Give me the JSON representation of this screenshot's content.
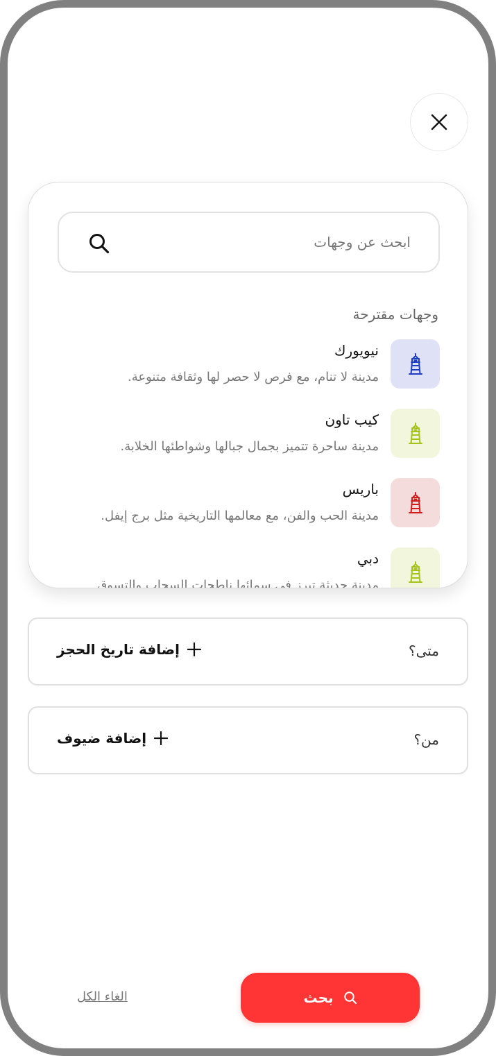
{
  "search": {
    "placeholder": "ابحث عن وجهات",
    "value": ""
  },
  "suggested": {
    "title": "وجهات مقترحة",
    "items": [
      {
        "name": "نيويورك",
        "description": "مدينة لا تنام، مع فرص لا حصر لها وثقافة متنوعة.",
        "thumb_bg": "#dfe1f7",
        "icon_color": "#1f3cc4",
        "icon": "lighthouse-icon"
      },
      {
        "name": "كيب تاون",
        "description": "مدينة ساحرة تتميز بجمال جبالها وشواطئها الخلابة.",
        "thumb_bg": "#f1f6dc",
        "icon_color": "#a6c21c",
        "icon": "lighthouse-icon"
      },
      {
        "name": "باريس",
        "description": "مدينة الحب والفن، مع معالمها التاريخية مثل برج إيفل.",
        "thumb_bg": "#f5dcdc",
        "icon_color": "#d31d1d",
        "icon": "lighthouse-icon"
      },
      {
        "name": "دبي",
        "description": "مدينة حديثة تبرز في سمائها ناطحات السحاب والتسوق",
        "thumb_bg": "#f1f6dc",
        "icon_color": "#a6c21c",
        "icon": "lighthouse-icon"
      }
    ]
  },
  "when": {
    "label": "متى؟",
    "action": "إضافة تاريخ الحجز"
  },
  "who": {
    "label": "من؟",
    "action": "إضافة ضيوف"
  },
  "footer": {
    "search_label": "بحث",
    "clear_label": "الغاء الكل"
  },
  "colors": {
    "accent": "#ff3535",
    "frame": "#808080"
  }
}
